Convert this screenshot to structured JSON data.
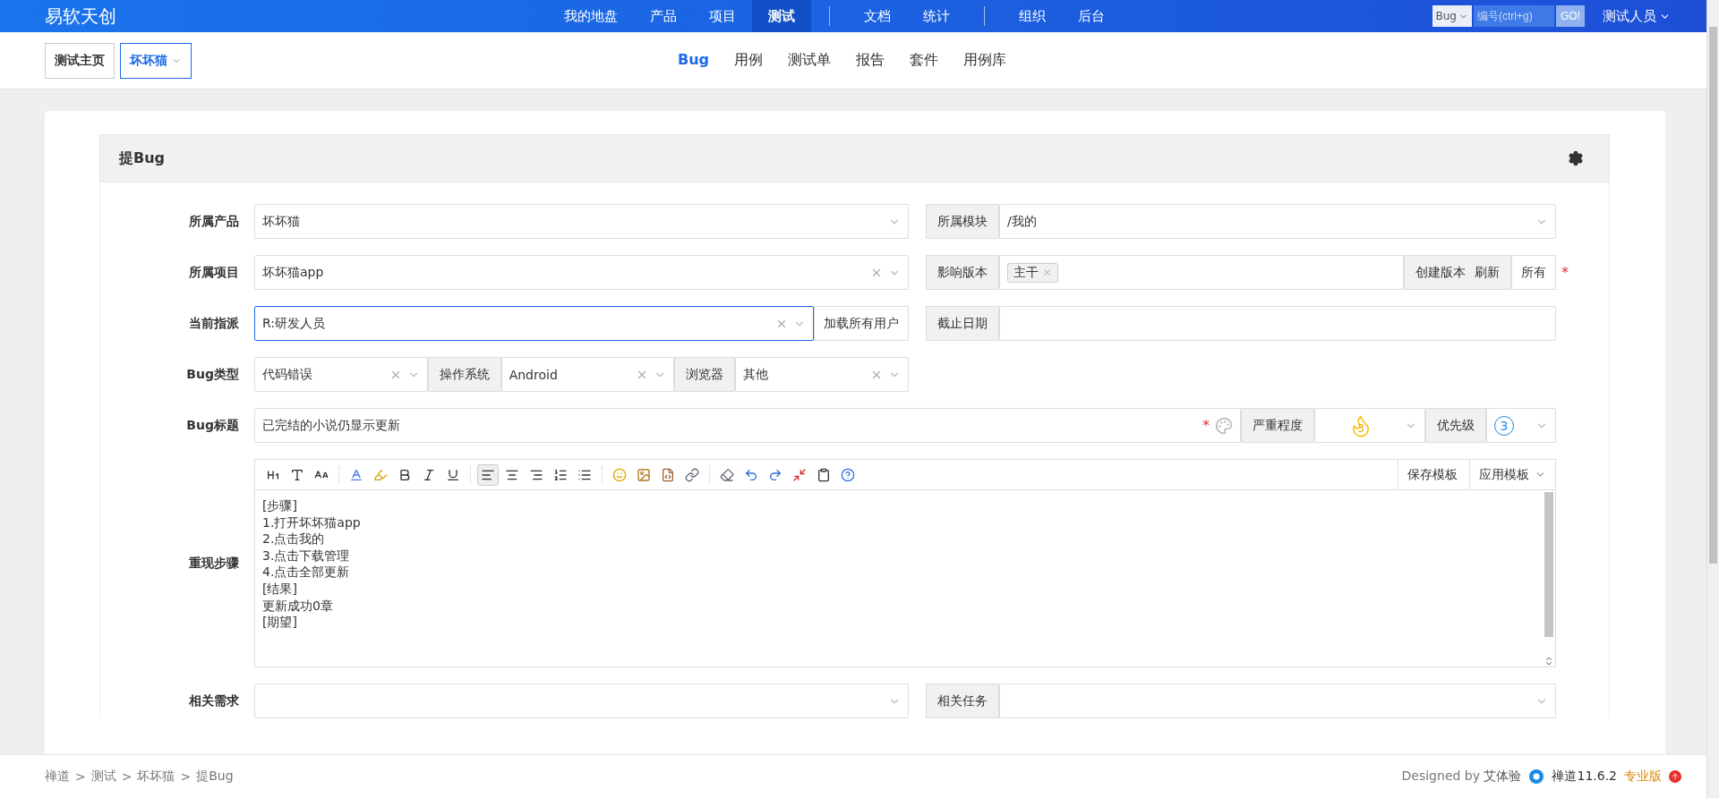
{
  "top_bar": {
    "logo": "易软天创",
    "nav_groups": [
      [
        {
          "label": "我的地盘",
          "selected": false
        },
        {
          "label": "产品",
          "selected": false
        },
        {
          "label": "项目",
          "selected": false
        },
        {
          "label": "测试",
          "selected": true
        }
      ],
      [
        {
          "label": "文档",
          "selected": false
        },
        {
          "label": "统计",
          "selected": false
        }
      ],
      [
        {
          "label": "组织",
          "selected": false
        },
        {
          "label": "后台",
          "selected": false
        }
      ]
    ],
    "search": {
      "type": "Bug",
      "placeholder": "编号(ctrl+g)",
      "go": "GO!"
    },
    "user": "测试人员"
  },
  "sub_nav": {
    "breadcrumbs": [
      {
        "label": "测试主页",
        "selected": false,
        "dropdown": false
      },
      {
        "label": "坏坏猫",
        "selected": true,
        "dropdown": true
      }
    ],
    "tabs": [
      {
        "label": "Bug",
        "selected": true
      },
      {
        "label": "用例",
        "selected": false
      },
      {
        "label": "测试单",
        "selected": false
      },
      {
        "label": "报告",
        "selected": false
      },
      {
        "label": "套件",
        "selected": false
      },
      {
        "label": "用例库",
        "selected": false
      }
    ]
  },
  "panel": {
    "title": "提Bug"
  },
  "form": {
    "product": {
      "label": "所属产品",
      "value": "坏坏猫"
    },
    "module": {
      "label": "所属模块",
      "value": "/我的"
    },
    "project": {
      "label": "所属项目",
      "value": "坏坏猫app"
    },
    "build": {
      "label": "影响版本",
      "tags": [
        "主干"
      ],
      "buttons": [
        "创建版本",
        "刷新"
      ],
      "addon": "所有",
      "required_mark": "*"
    },
    "assigned": {
      "label": "当前指派",
      "value": "R:研发人员",
      "focused": true,
      "button": "加载所有用户"
    },
    "deadline": {
      "label": "截止日期"
    },
    "type": {
      "label": "Bug类型",
      "value": "代码错误"
    },
    "os": {
      "label": "操作系统",
      "value": "Android"
    },
    "browser": {
      "label": "浏览器",
      "value": "其他"
    },
    "title": {
      "label": "Bug标题",
      "value": "已完结的小说仍显示更新",
      "required_mark": "*"
    },
    "severity": {
      "label": "严重程度",
      "value": "3"
    },
    "priority": {
      "label": "优先级",
      "value": "3"
    },
    "steps": {
      "label": "重现步骤",
      "save_template": "保存模板",
      "apply_template": "应用模板",
      "toolbar": [
        {
          "kind": "heading",
          "selected": false
        },
        {
          "kind": "font",
          "selected": false
        },
        {
          "kind": "size",
          "selected": false
        },
        {
          "kind": "sep"
        },
        {
          "kind": "color",
          "selected": false
        },
        {
          "kind": "highlight",
          "selected": false
        },
        {
          "kind": "bold",
          "selected": false
        },
        {
          "kind": "italic",
          "selected": false
        },
        {
          "kind": "underline",
          "selected": false
        },
        {
          "kind": "sep"
        },
        {
          "kind": "align-left",
          "selected": true
        },
        {
          "kind": "align-center",
          "selected": false
        },
        {
          "kind": "align-right",
          "selected": false
        },
        {
          "kind": "ordered-list",
          "selected": false
        },
        {
          "kind": "bullet-list",
          "selected": false
        },
        {
          "kind": "sep"
        },
        {
          "kind": "emoji",
          "selected": false
        },
        {
          "kind": "image",
          "selected": false
        },
        {
          "kind": "code",
          "selected": false
        },
        {
          "kind": "link",
          "selected": false
        },
        {
          "kind": "sep"
        },
        {
          "kind": "eraser",
          "selected": false
        },
        {
          "kind": "undo",
          "selected": false
        },
        {
          "kind": "redo",
          "selected": false
        },
        {
          "kind": "fullscreen",
          "selected": false
        },
        {
          "kind": "paste",
          "selected": false
        },
        {
          "kind": "help",
          "selected": false
        }
      ],
      "lines": [
        "[步骤]",
        "1.打开坏坏猫app",
        "2.点击我的",
        "3.点击下载管理",
        "4.点击全部更新",
        "[结果]",
        "更新成功0章",
        "[期望]"
      ]
    },
    "story": {
      "label": "相关需求"
    },
    "task": {
      "label": "相关任务"
    }
  },
  "footer": {
    "separator": ">",
    "breadcrumbs": [
      "禅道",
      "测试",
      "坏坏猫",
      "提Bug"
    ],
    "designed_by": "Designed by",
    "designer": "艾体验",
    "version": "禅道11.6.2",
    "edition": "专业版"
  }
}
